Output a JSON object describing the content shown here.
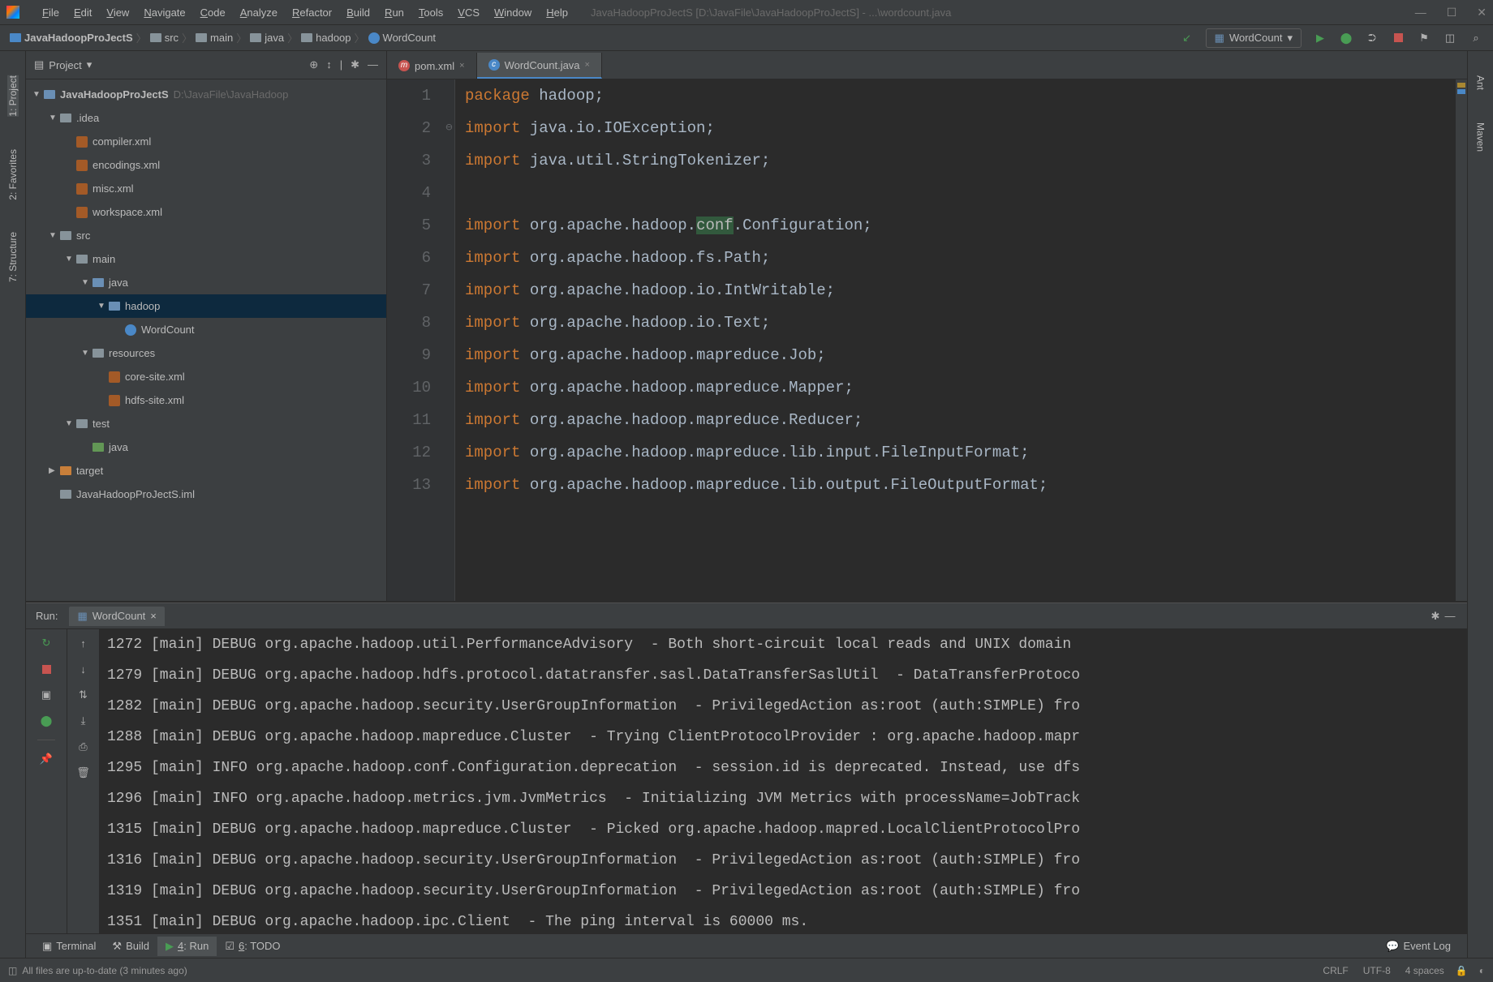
{
  "titlebar": {
    "menu": [
      "File",
      "Edit",
      "View",
      "Navigate",
      "Code",
      "Analyze",
      "Refactor",
      "Build",
      "Run",
      "Tools",
      "VCS",
      "Window",
      "Help"
    ],
    "title": "JavaHadoopProJectS [D:\\JavaFile\\JavaHadoopProJectS] - ...\\wordcount.java"
  },
  "breadcrumb": [
    "JavaHadoopProJectS",
    "src",
    "main",
    "java",
    "hadoop",
    "WordCount"
  ],
  "run_config": "WordCount",
  "left_tools": [
    "1: Project",
    "2: Favorites",
    "7: Structure"
  ],
  "right_tools": [
    "Ant",
    "Maven"
  ],
  "project_panel": {
    "title": "Project",
    "root_label": "JavaHadoopProJectS",
    "root_path": "D:\\JavaFile\\JavaHadoop",
    "tree": [
      {
        "indent": 1,
        "arrow": "▼",
        "icon": "folder",
        "label": ".idea"
      },
      {
        "indent": 2,
        "arrow": "",
        "icon": "xml",
        "label": "compiler.xml"
      },
      {
        "indent": 2,
        "arrow": "",
        "icon": "xml",
        "label": "encodings.xml"
      },
      {
        "indent": 2,
        "arrow": "",
        "icon": "xml",
        "label": "misc.xml"
      },
      {
        "indent": 2,
        "arrow": "",
        "icon": "xml",
        "label": "workspace.xml"
      },
      {
        "indent": 1,
        "arrow": "▼",
        "icon": "folder",
        "label": "src"
      },
      {
        "indent": 2,
        "arrow": "▼",
        "icon": "folder",
        "label": "main"
      },
      {
        "indent": 3,
        "arrow": "▼",
        "icon": "folder-b",
        "label": "java"
      },
      {
        "indent": 4,
        "arrow": "▼",
        "icon": "folder-b",
        "label": "hadoop",
        "selected": true
      },
      {
        "indent": 5,
        "arrow": "",
        "icon": "class",
        "label": "WordCount"
      },
      {
        "indent": 3,
        "arrow": "▼",
        "icon": "folder",
        "label": "resources"
      },
      {
        "indent": 4,
        "arrow": "",
        "icon": "xml",
        "label": "core-site.xml"
      },
      {
        "indent": 4,
        "arrow": "",
        "icon": "xml",
        "label": "hdfs-site.xml"
      },
      {
        "indent": 2,
        "arrow": "▼",
        "icon": "folder",
        "label": "test"
      },
      {
        "indent": 3,
        "arrow": "",
        "icon": "folder-g",
        "label": "java"
      },
      {
        "indent": 1,
        "arrow": "▶",
        "icon": "folder-o",
        "label": "target"
      },
      {
        "indent": 1,
        "arrow": "",
        "icon": "folder",
        "label": "JavaHadoopProJectS.iml"
      }
    ]
  },
  "editor": {
    "tabs": [
      {
        "label": "pom.xml",
        "active": false,
        "icon": "m"
      },
      {
        "label": "WordCount.java",
        "active": true,
        "icon": "c"
      }
    ],
    "lines": [
      {
        "n": 1,
        "tokens": [
          [
            "kw",
            "package"
          ],
          [
            "pkg",
            " hadoop;"
          ]
        ]
      },
      {
        "n": 2,
        "tokens": [
          [
            "kw",
            "import"
          ],
          [
            "pkg",
            " java.io.IOException;"
          ]
        ]
      },
      {
        "n": 3,
        "tokens": [
          [
            "kw",
            "import"
          ],
          [
            "pkg",
            " java.util.StringTokenizer;"
          ]
        ]
      },
      {
        "n": 4,
        "tokens": []
      },
      {
        "n": 5,
        "tokens": [
          [
            "kw",
            "import"
          ],
          [
            "pkg",
            " org.apache.hadoop."
          ],
          [
            "hl",
            "conf"
          ],
          [
            "pkg",
            ".Configuration;"
          ]
        ]
      },
      {
        "n": 6,
        "tokens": [
          [
            "kw",
            "import"
          ],
          [
            "pkg",
            " org.apache.hadoop.fs.Path;"
          ]
        ]
      },
      {
        "n": 7,
        "tokens": [
          [
            "kw",
            "import"
          ],
          [
            "pkg",
            " org.apache.hadoop.io.IntWritable;"
          ]
        ]
      },
      {
        "n": 8,
        "tokens": [
          [
            "kw",
            "import"
          ],
          [
            "pkg",
            " org.apache.hadoop.io.Text;"
          ]
        ]
      },
      {
        "n": 9,
        "tokens": [
          [
            "kw",
            "import"
          ],
          [
            "pkg",
            " org.apache.hadoop.mapreduce.Job;"
          ]
        ]
      },
      {
        "n": 10,
        "tokens": [
          [
            "kw",
            "import"
          ],
          [
            "pkg",
            " org.apache.hadoop.mapreduce.Mapper;"
          ]
        ]
      },
      {
        "n": 11,
        "tokens": [
          [
            "kw",
            "import"
          ],
          [
            "pkg",
            " org.apache.hadoop.mapreduce.Reducer;"
          ]
        ]
      },
      {
        "n": 12,
        "tokens": [
          [
            "kw",
            "import"
          ],
          [
            "pkg",
            " org.apache.hadoop.mapreduce.lib.input.FileInputFormat;"
          ]
        ]
      },
      {
        "n": 13,
        "tokens": [
          [
            "kw",
            "import"
          ],
          [
            "pkg",
            " org.apache.hadoop.mapreduce.lib.output.FileOutputFormat;"
          ]
        ]
      }
    ]
  },
  "run": {
    "label": "Run:",
    "tab": "WordCount",
    "lines": [
      "1272 [main] DEBUG org.apache.hadoop.util.PerformanceAdvisory  - Both short-circuit local reads and UNIX domain",
      "1279 [main] DEBUG org.apache.hadoop.hdfs.protocol.datatransfer.sasl.DataTransferSaslUtil  - DataTransferProtoco",
      "1282 [main] DEBUG org.apache.hadoop.security.UserGroupInformation  - PrivilegedAction as:root (auth:SIMPLE) fro",
      "1288 [main] DEBUG org.apache.hadoop.mapreduce.Cluster  - Trying ClientProtocolProvider : org.apache.hadoop.mapr",
      "1295 [main] INFO org.apache.hadoop.conf.Configuration.deprecation  - session.id is deprecated. Instead, use dfs",
      "1296 [main] INFO org.apache.hadoop.metrics.jvm.JvmMetrics  - Initializing JVM Metrics with processName=JobTrack",
      "1315 [main] DEBUG org.apache.hadoop.mapreduce.Cluster  - Picked org.apache.hadoop.mapred.LocalClientProtocolPro",
      "1316 [main] DEBUG org.apache.hadoop.security.UserGroupInformation  - PrivilegedAction as:root (auth:SIMPLE) fro",
      "1319 [main] DEBUG org.apache.hadoop.security.UserGroupInformation  - PrivilegedAction as:root (auth:SIMPLE) fro",
      "1351 [main] DEBUG org.apache.hadoop.ipc.Client  - The ping interval is 60000 ms."
    ]
  },
  "bottom_tabs": [
    "Terminal",
    "Build",
    "4: Run",
    "6: TODO"
  ],
  "event_log": "Event Log",
  "status": {
    "message": "All files are up-to-date (3 minutes ago)",
    "right": [
      "CRLF",
      "UTF-8",
      "4 spaces"
    ]
  }
}
